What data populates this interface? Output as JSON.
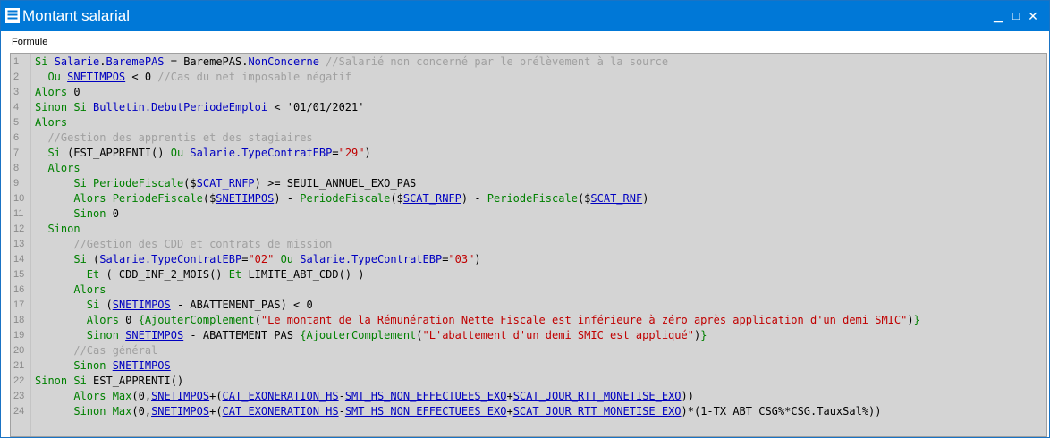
{
  "window": {
    "title": "Montant salarial",
    "controls": {
      "minimize": "▁",
      "maximize": "□",
      "close": "✕"
    }
  },
  "editor": {
    "label": "Formule",
    "lines": [
      {
        "n": "1",
        "tokens": [
          [
            "kw",
            "Si "
          ],
          [
            "fld",
            "Salarie"
          ],
          [
            "op",
            "."
          ],
          [
            "fld",
            "BaremePAS"
          ],
          [
            "op",
            " = BaremePAS."
          ],
          [
            "fld",
            "NonConcerne"
          ],
          [
            "cm",
            " //Salarié non concerné par le prélèvement à la source"
          ]
        ]
      },
      {
        "n": "2",
        "tokens": [
          [
            "kw",
            "  Ou "
          ],
          [
            "ul",
            "SNETIMPOS"
          ],
          [
            "op",
            " < 0 "
          ],
          [
            "cm",
            "//Cas du net imposable négatif"
          ]
        ]
      },
      {
        "n": "3",
        "tokens": [
          [
            "kw",
            "Alors "
          ],
          [
            "op",
            "0"
          ]
        ]
      },
      {
        "n": "4",
        "tokens": [
          [
            "kw",
            "Sinon Si "
          ],
          [
            "fld",
            "Bulletin.DebutPeriodeEmploi"
          ],
          [
            "op",
            " < '01/01/2021'"
          ]
        ]
      },
      {
        "n": "5",
        "tokens": [
          [
            "kw",
            "Alors"
          ]
        ]
      },
      {
        "n": "6",
        "tokens": [
          [
            "cm",
            "  //Gestion des apprentis et des stagiaires"
          ]
        ]
      },
      {
        "n": "7",
        "tokens": [
          [
            "kw",
            "  Si "
          ],
          [
            "op",
            "(EST_APPRENTI() "
          ],
          [
            "kw",
            "Ou "
          ],
          [
            "fld",
            "Salarie.TypeContratEBP"
          ],
          [
            "op",
            "="
          ],
          [
            "str",
            "\"29\""
          ],
          [
            "op",
            ")"
          ]
        ]
      },
      {
        "n": "8",
        "tokens": [
          [
            "kw",
            "  Alors"
          ]
        ]
      },
      {
        "n": "9",
        "tokens": [
          [
            "kw",
            "      Si PeriodeFiscale"
          ],
          [
            "op",
            "($"
          ],
          [
            "fld",
            "SCAT_RNFP"
          ],
          [
            "op",
            ") >= SEUIL_ANNUEL_EXO_PAS"
          ]
        ]
      },
      {
        "n": "10",
        "tokens": [
          [
            "kw",
            "      Alors PeriodeFiscale"
          ],
          [
            "op",
            "($"
          ],
          [
            "ul",
            "SNETIMPOS"
          ],
          [
            "op",
            ") - "
          ],
          [
            "kw",
            "PeriodeFiscale"
          ],
          [
            "op",
            "($"
          ],
          [
            "ul",
            "SCAT_RNFP"
          ],
          [
            "op",
            ") - "
          ],
          [
            "kw",
            "PeriodeFiscale"
          ],
          [
            "op",
            "($"
          ],
          [
            "ul",
            "SCAT_RNF"
          ],
          [
            "op",
            ")"
          ]
        ]
      },
      {
        "n": "11",
        "tokens": [
          [
            "kw",
            "      Sinon "
          ],
          [
            "op",
            "0"
          ]
        ]
      },
      {
        "n": "12",
        "tokens": [
          [
            "kw",
            "  Sinon"
          ]
        ]
      },
      {
        "n": "13",
        "tokens": [
          [
            "cm",
            "      //Gestion des CDD et contrats de mission"
          ]
        ]
      },
      {
        "n": "14",
        "tokens": [
          [
            "kw",
            "      Si "
          ],
          [
            "op",
            "("
          ],
          [
            "fld",
            "Salarie.TypeContratEBP"
          ],
          [
            "op",
            "="
          ],
          [
            "str",
            "\"02\""
          ],
          [
            "kw",
            " Ou "
          ],
          [
            "fld",
            "Salarie.TypeContratEBP"
          ],
          [
            "op",
            "="
          ],
          [
            "str",
            "\"03\""
          ],
          [
            "op",
            ")"
          ]
        ]
      },
      {
        "n": "15",
        "tokens": [
          [
            "kw",
            "        Et "
          ],
          [
            "op",
            "( CDD_INF_2_MOIS() "
          ],
          [
            "kw",
            "Et "
          ],
          [
            "op",
            "LIMITE_ABT_CDD() )"
          ]
        ]
      },
      {
        "n": "16",
        "tokens": [
          [
            "kw",
            "      Alors"
          ]
        ]
      },
      {
        "n": "17",
        "tokens": [
          [
            "kw",
            "        Si "
          ],
          [
            "op",
            "("
          ],
          [
            "ul",
            "SNETIMPOS"
          ],
          [
            "op",
            " - ABATTEMENT_PAS) < 0"
          ]
        ]
      },
      {
        "n": "18",
        "tokens": [
          [
            "kw",
            "        Alors "
          ],
          [
            "op",
            "0 "
          ],
          [
            "kw",
            "{AjouterComplement"
          ],
          [
            "op",
            "("
          ],
          [
            "str",
            "\"Le montant de la Rémunération Nette Fiscale est inférieure à zéro après application d'un demi SMIC\""
          ],
          [
            "op",
            ")"
          ],
          [
            "kw",
            "}"
          ]
        ]
      },
      {
        "n": "19",
        "tokens": [
          [
            "kw",
            "        Sinon "
          ],
          [
            "ul",
            "SNETIMPOS"
          ],
          [
            "op",
            " - ABATTEMENT_PAS "
          ],
          [
            "kw",
            "{AjouterComplement"
          ],
          [
            "op",
            "("
          ],
          [
            "str",
            "\"L'abattement d'un demi SMIC est appliqué\""
          ],
          [
            "op",
            ")"
          ],
          [
            "kw",
            "}"
          ]
        ]
      },
      {
        "n": "20",
        "tokens": [
          [
            "cm",
            "      //Cas général"
          ]
        ]
      },
      {
        "n": "21",
        "tokens": [
          [
            "kw",
            "      Sinon "
          ],
          [
            "ul",
            "SNETIMPOS"
          ]
        ]
      },
      {
        "n": "22",
        "tokens": [
          [
            "kw",
            "Sinon Si "
          ],
          [
            "op",
            "EST_APPRENTI()"
          ]
        ]
      },
      {
        "n": "23",
        "tokens": [
          [
            "kw",
            "      Alors Max"
          ],
          [
            "op",
            "(0,"
          ],
          [
            "ul",
            "SNETIMPOS"
          ],
          [
            "op",
            "+("
          ],
          [
            "ul",
            "CAT_EXONERATION_HS"
          ],
          [
            "op",
            "-"
          ],
          [
            "ul",
            "SMT_HS_NON_EFFECTUEES_EXO"
          ],
          [
            "op",
            "+"
          ],
          [
            "ul",
            "SCAT_JOUR_RTT_MONETISE_EXO"
          ],
          [
            "op",
            "))"
          ]
        ]
      },
      {
        "n": "24",
        "tokens": [
          [
            "kw",
            "      Sinon Max"
          ],
          [
            "op",
            "(0,"
          ],
          [
            "ul",
            "SNETIMPOS"
          ],
          [
            "op",
            "+("
          ],
          [
            "ul",
            "CAT_EXONERATION_HS"
          ],
          [
            "op",
            "-"
          ],
          [
            "ul",
            "SMT_HS_NON_EFFECTUEES_EXO"
          ],
          [
            "op",
            "+"
          ],
          [
            "ul",
            "SCAT_JOUR_RTT_MONETISE_EXO"
          ],
          [
            "op",
            ")*(1-TX_ABT_CSG%*CSG.TauxSal%))"
          ]
        ]
      }
    ]
  }
}
